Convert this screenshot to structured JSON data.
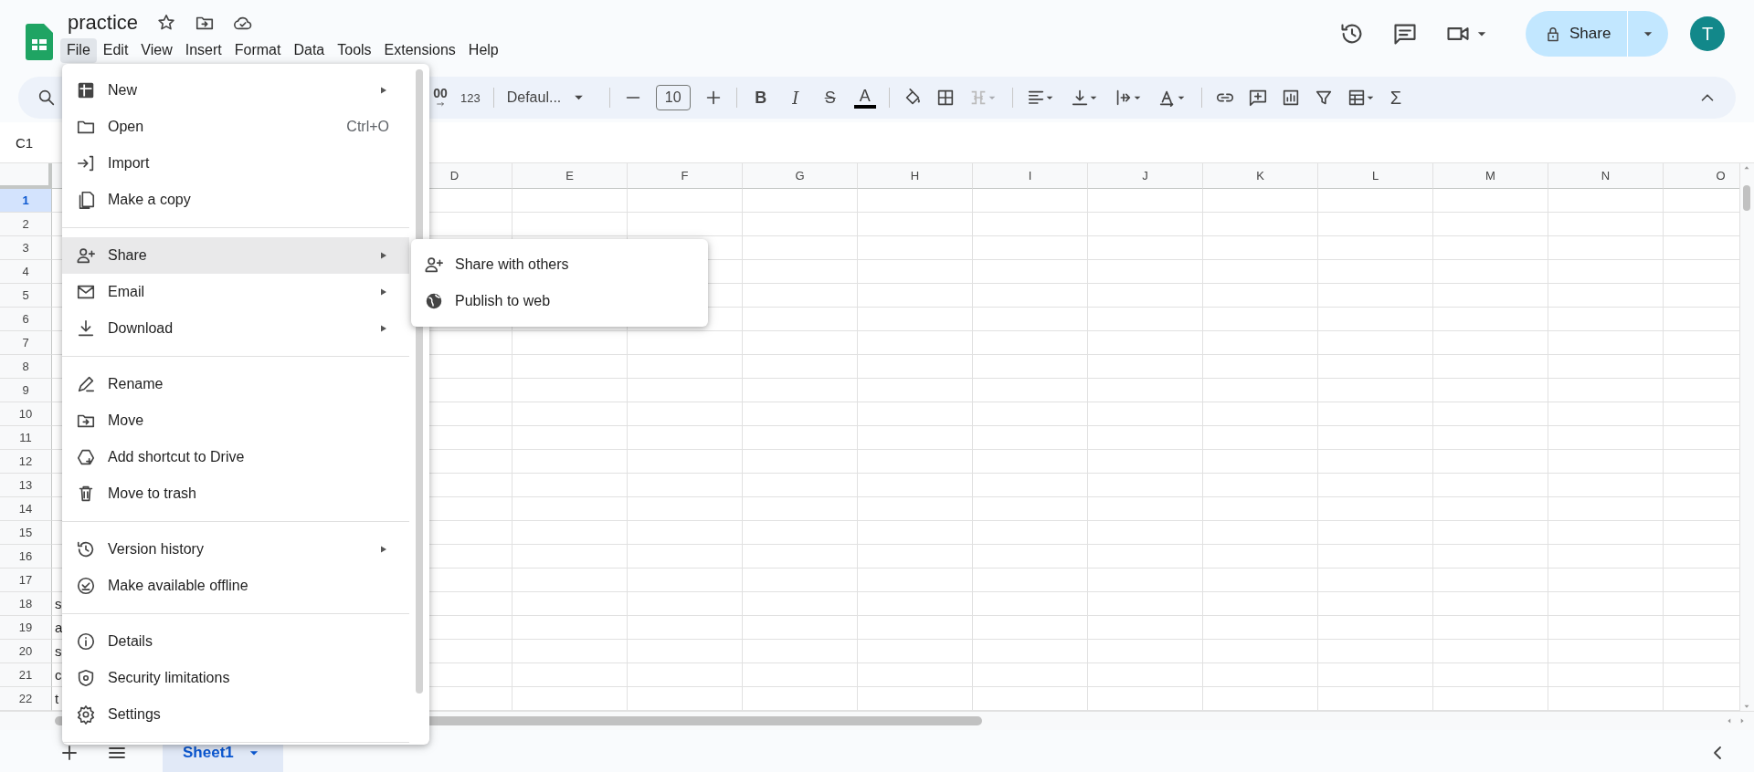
{
  "document": {
    "title": "practice"
  },
  "menu_bar": [
    {
      "label": "File",
      "selected": true
    },
    {
      "label": "Edit",
      "selected": false
    },
    {
      "label": "View",
      "selected": false
    },
    {
      "label": "Insert",
      "selected": false
    },
    {
      "label": "Format",
      "selected": false
    },
    {
      "label": "Data",
      "selected": false
    },
    {
      "label": "Tools",
      "selected": false
    },
    {
      "label": "Extensions",
      "selected": false
    },
    {
      "label": "Help",
      "selected": false
    }
  ],
  "share_button": {
    "label": "Share"
  },
  "avatar": {
    "initial": "T"
  },
  "toolbar": {
    "decimal_button": "00",
    "number_format": "123",
    "font": "Defaul...",
    "font_size": "10",
    "text_style_buttons": [
      {
        "kind": "bold",
        "glyph": "B"
      },
      {
        "kind": "italic",
        "glyph": "I"
      },
      {
        "kind": "strikethrough",
        "glyph": "S"
      },
      {
        "kind": "text_color",
        "glyph": "A"
      }
    ],
    "merge_disabled": true,
    "function_button": "Σ"
  },
  "name_box": "C1",
  "columns": [
    "D",
    "E",
    "F",
    "G",
    "H",
    "I",
    "J",
    "K",
    "L",
    "M",
    "N",
    "O"
  ],
  "rows": [
    {
      "number": "1",
      "selected": true
    },
    {
      "number": "2",
      "selected": false
    },
    {
      "number": "3",
      "selected": false
    },
    {
      "number": "4",
      "selected": false
    },
    {
      "number": "5",
      "selected": false
    },
    {
      "number": "6",
      "selected": false
    },
    {
      "number": "7",
      "selected": false
    },
    {
      "number": "8",
      "selected": false
    },
    {
      "number": "9",
      "selected": false
    },
    {
      "number": "10",
      "selected": false
    },
    {
      "number": "11",
      "selected": false
    },
    {
      "number": "12",
      "selected": false
    },
    {
      "number": "13",
      "selected": false
    },
    {
      "number": "14",
      "selected": false
    },
    {
      "number": "15",
      "selected": false
    },
    {
      "number": "16",
      "selected": false
    },
    {
      "number": "17",
      "selected": false
    },
    {
      "number": "18",
      "selected": false,
      "column_1": "s"
    },
    {
      "number": "19",
      "selected": false,
      "column_1": "a"
    },
    {
      "number": "20",
      "selected": false,
      "column_1": "s"
    },
    {
      "number": "21",
      "selected": false,
      "column_1": "c"
    },
    {
      "number": "22",
      "selected": false,
      "column_1": "t"
    }
  ],
  "file_menu": {
    "groups": [
      {
        "items": [
          {
            "label": "New",
            "has_submenu": true,
            "selected": false
          },
          {
            "label": "Open",
            "shortcut": "Ctrl+O",
            "has_submenu": false,
            "selected": false
          },
          {
            "label": "Import",
            "has_submenu": false,
            "selected": false
          },
          {
            "label": "Make a copy",
            "has_submenu": false,
            "selected": false
          }
        ]
      },
      {
        "items": [
          {
            "label": "Share",
            "has_submenu": true,
            "selected": true
          },
          {
            "label": "Email",
            "has_submenu": true,
            "selected": false
          },
          {
            "label": "Download",
            "has_submenu": true,
            "selected": false
          }
        ]
      },
      {
        "items": [
          {
            "label": "Rename",
            "has_submenu": false,
            "selected": false
          },
          {
            "label": "Move",
            "has_submenu": false,
            "selected": false
          },
          {
            "label": "Add shortcut to Drive",
            "has_submenu": false,
            "selected": false
          },
          {
            "label": "Move to trash",
            "has_submenu": false,
            "selected": false
          }
        ]
      },
      {
        "items": [
          {
            "label": "Version history",
            "has_submenu": true,
            "selected": false
          },
          {
            "label": "Make available offline",
            "has_submenu": false,
            "selected": false
          }
        ]
      },
      {
        "items": [
          {
            "label": "Details",
            "has_submenu": false,
            "selected": false
          },
          {
            "label": "Security limitations",
            "has_submenu": false,
            "selected": false
          },
          {
            "label": "Settings",
            "has_submenu": false,
            "selected": false
          }
        ]
      }
    ]
  },
  "share_submenu": {
    "items": [
      {
        "label": "Share with others"
      },
      {
        "label": "Publish to web"
      }
    ]
  },
  "sheet_tabs": [
    {
      "label": "Sheet1",
      "selected": true
    }
  ]
}
